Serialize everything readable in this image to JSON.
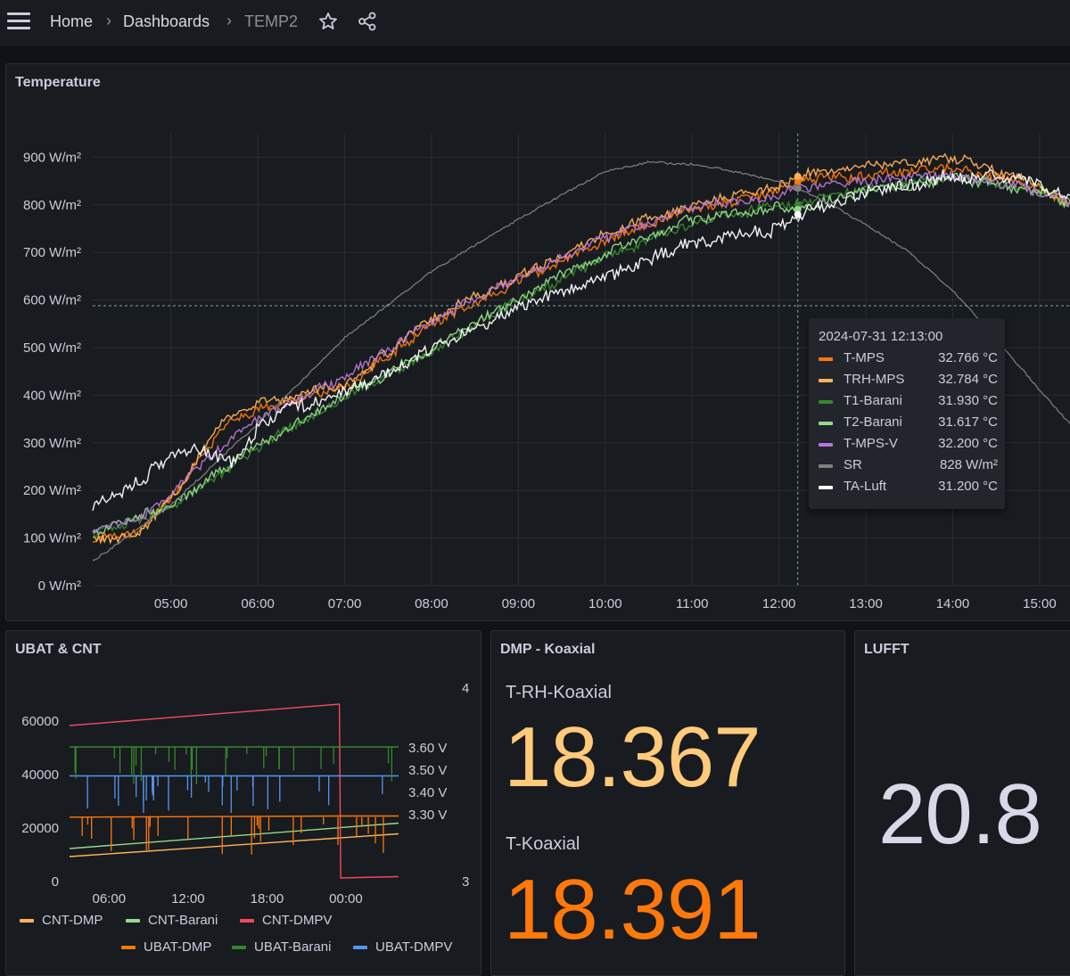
{
  "breadcrumb": {
    "home": "Home",
    "dashboards": "Dashboards",
    "current": "TEMP2",
    "separator": "›"
  },
  "icons": {
    "menu": "hamburger-menu-icon",
    "star": "star-icon",
    "share": "share-icon"
  },
  "temperature_panel": {
    "title": "Temperature",
    "tooltip": {
      "time": "2024-07-31 12:13:00",
      "rows": [
        {
          "name": "T-MPS",
          "value": "32.766 °C",
          "color": "#ff780a"
        },
        {
          "name": "TRH-MPS",
          "value": "32.784 °C",
          "color": "#ffb357"
        },
        {
          "name": "T1-Barani",
          "value": "31.930 °C",
          "color": "#37872d"
        },
        {
          "name": "T2-Barani",
          "value": "31.617 °C",
          "color": "#96d98d"
        },
        {
          "name": "T-MPS-V",
          "value": "32.200 °C",
          "color": "#b877d9"
        },
        {
          "name": "SR",
          "value": "828 W/m²",
          "color": "#808080"
        },
        {
          "name": "TA-Luft",
          "value": "31.200 °C",
          "color": "#ffffff"
        }
      ]
    }
  },
  "ubat_panel": {
    "title": "UBAT & CNT",
    "legend": [
      {
        "name": "CNT-DMP",
        "color": "#ffb357"
      },
      {
        "name": "CNT-Barani",
        "color": "#96d98d"
      },
      {
        "name": "CNT-DMPV",
        "color": "#f2495c"
      },
      {
        "name": "UBAT-DMP",
        "color": "#ff780a"
      },
      {
        "name": "UBAT-Barani",
        "color": "#37872d"
      },
      {
        "name": "UBAT-DMPV",
        "color": "#5794f2"
      }
    ]
  },
  "dmp_panel": {
    "title": "DMP - Koaxial",
    "stats": [
      {
        "label": "T-RH-Koaxial",
        "value": "18.367",
        "color": "#ffca7a"
      },
      {
        "label": "T-Koaxial",
        "value": "18.391",
        "color": "#ff780a"
      }
    ]
  },
  "lufft_panel": {
    "title": "LUFFT",
    "value": "20.8",
    "color": "#d8d9e8"
  },
  "chart_data": [
    {
      "type": "line",
      "title": "Temperature",
      "x_ticks": [
        "05:00",
        "06:00",
        "07:00",
        "08:00",
        "09:00",
        "10:00",
        "11:00",
        "12:00",
        "13:00",
        "14:00",
        "15:00"
      ],
      "y_ticks": [
        "0 W/m²",
        "100 W/m²",
        "200 W/m²",
        "300 W/m²",
        "400 W/m²",
        "500 W/m²",
        "600 W/m²",
        "700 W/m²",
        "800 W/m²",
        "900 W/m²"
      ],
      "ylim": [
        0,
        950
      ],
      "grid": true,
      "crosshair_time": "12:13",
      "series": [
        {
          "name": "T-MPS",
          "color": "#ff780a",
          "hours": [
            4.1,
            4.6,
            5.0,
            5.6,
            6.0,
            7.0,
            8.0,
            9.0,
            10.0,
            11.0,
            12.0,
            12.22,
            13.0,
            14.0,
            15.0,
            15.35
          ],
          "values": [
            100,
            110,
            180,
            335,
            370,
            415,
            550,
            640,
            725,
            790,
            830,
            850,
            860,
            880,
            835,
            800
          ]
        },
        {
          "name": "TRH-MPS",
          "color": "#ffb357",
          "hours": [
            4.1,
            4.6,
            5.0,
            5.6,
            6.0,
            7.0,
            8.0,
            9.0,
            10.0,
            11.0,
            12.0,
            12.22,
            13.0,
            14.0,
            15.0,
            15.35
          ],
          "values": [
            95,
            105,
            180,
            350,
            385,
            420,
            560,
            650,
            740,
            800,
            840,
            860,
            880,
            900,
            840,
            800
          ]
        },
        {
          "name": "T1-Barani",
          "color": "#37872d",
          "hours": [
            4.1,
            5.0,
            6.0,
            7.0,
            8.0,
            9.0,
            10.0,
            11.0,
            12.0,
            12.22,
            13.0,
            14.0,
            15.0,
            15.35
          ],
          "values": [
            105,
            165,
            290,
            395,
            490,
            600,
            690,
            760,
            800,
            800,
            835,
            860,
            830,
            800
          ]
        },
        {
          "name": "T2-Barani",
          "color": "#96d98d",
          "hours": [
            4.1,
            5.0,
            6.0,
            7.0,
            8.0,
            9.0,
            10.0,
            11.0,
            12.0,
            12.22,
            13.0,
            14.0,
            15.0,
            15.35
          ],
          "values": [
            108,
            170,
            295,
            398,
            495,
            605,
            700,
            770,
            795,
            790,
            830,
            855,
            830,
            800
          ]
        },
        {
          "name": "T-MPS-V",
          "color": "#b877d9",
          "hours": [
            4.1,
            4.6,
            5.0,
            5.8,
            6.2,
            7.0,
            8.0,
            9.0,
            10.0,
            11.0,
            12.0,
            12.22,
            13.0,
            14.0,
            15.0,
            15.35
          ],
          "values": [
            115,
            135,
            195,
            330,
            370,
            440,
            555,
            650,
            730,
            795,
            820,
            835,
            850,
            860,
            830,
            800
          ]
        },
        {
          "name": "SR",
          "color": "#808080",
          "hours": [
            4.1,
            5.0,
            6.0,
            7.0,
            8.0,
            9.0,
            10.0,
            10.5,
            11.0,
            11.5,
            12.0,
            12.22,
            12.8,
            13.5,
            14.0,
            14.5,
            15.0,
            15.35
          ],
          "values": [
            50,
            170,
            340,
            520,
            660,
            770,
            870,
            890,
            885,
            870,
            850,
            835,
            780,
            700,
            620,
            520,
            410,
            340
          ]
        },
        {
          "name": "TA-Luft",
          "color": "#ffffff",
          "hours": [
            4.1,
            4.4,
            5.0,
            5.3,
            5.7,
            6.0,
            6.3,
            7.0,
            8.0,
            9.0,
            10.0,
            11.0,
            12.0,
            12.22,
            13.0,
            14.0,
            14.6,
            15.0,
            15.35
          ],
          "values": [
            165,
            190,
            270,
            285,
            255,
            330,
            370,
            405,
            500,
            580,
            650,
            720,
            750,
            780,
            830,
            860,
            860,
            840,
            820
          ]
        }
      ]
    },
    {
      "type": "line",
      "title": "UBAT & CNT",
      "x_ticks": [
        "06:00",
        "12:00",
        "18:00",
        "00:00"
      ],
      "y_left_ticks": [
        "0",
        "20000",
        "40000",
        "60000"
      ],
      "y_right_ticks": [
        "3",
        "3.30 V",
        "3.40 V",
        "3.50 V",
        "3.60 V",
        "4"
      ],
      "series": [
        {
          "name": "CNT-DMP",
          "color": "#ffb357",
          "axis": "left",
          "hours": [
            3,
            28
          ],
          "values": [
            9000,
            17500
          ]
        },
        {
          "name": "CNT-Barani",
          "color": "#96d98d",
          "axis": "left",
          "hours": [
            3,
            28
          ],
          "values": [
            12000,
            21500
          ]
        },
        {
          "name": "CNT-DMPV",
          "color": "#f2495c",
          "axis": "left",
          "hours": [
            3,
            23.5,
            23.6,
            28
          ],
          "values": [
            58000,
            66000,
            1000,
            1500
          ]
        },
        {
          "name": "UBAT-DMP",
          "color": "#ff780a",
          "axis": "right",
          "hours": [
            3,
            23.5,
            28
          ],
          "values": [
            3.285,
            3.29,
            3.29
          ]
        },
        {
          "name": "UBAT-Barani",
          "color": "#37872d",
          "axis": "right",
          "hours": [
            3,
            28
          ],
          "values": [
            3.6,
            3.6
          ]
        },
        {
          "name": "UBAT-DMPV",
          "color": "#5794f2",
          "axis": "right",
          "hours": [
            3,
            28
          ],
          "values": [
            3.47,
            3.47
          ]
        }
      ]
    }
  ]
}
